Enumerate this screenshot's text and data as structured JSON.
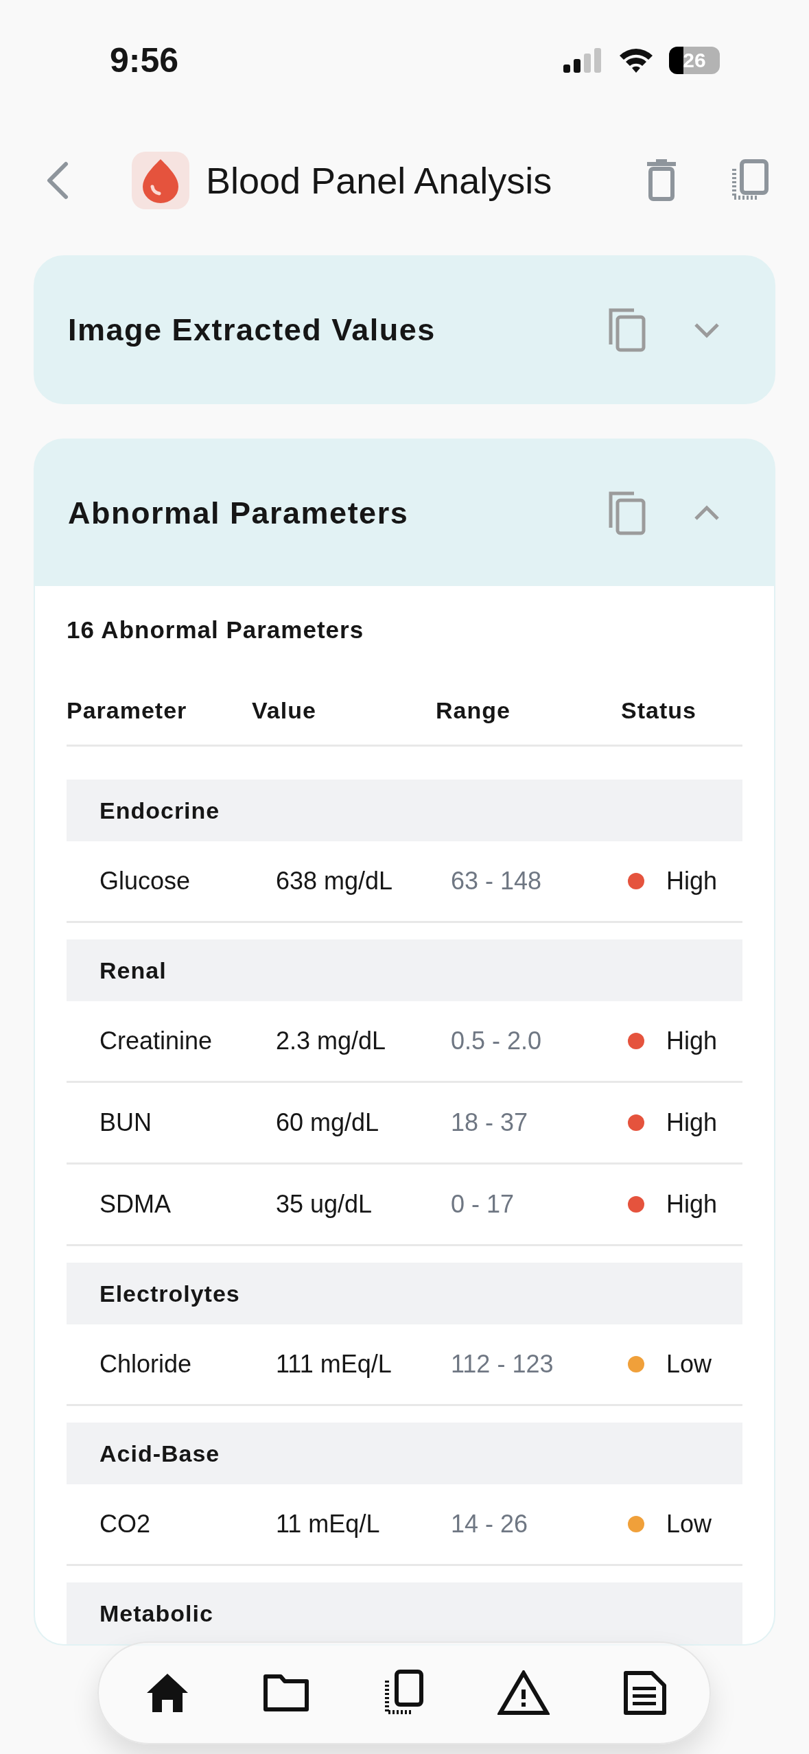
{
  "status_bar": {
    "time": "9:56",
    "battery": "26"
  },
  "header": {
    "title": "Blood Panel Analysis"
  },
  "sections": [
    {
      "title": "Image Extracted Values",
      "expanded": false
    },
    {
      "title": "Abnormal Parameters",
      "expanded": true,
      "summary": "16 Abnormal Parameters",
      "columns": [
        "Parameter",
        "Value",
        "Range",
        "Status"
      ],
      "groups": [
        {
          "name": "Endocrine",
          "rows": [
            {
              "parameter": "Glucose",
              "value": "638 mg/dL",
              "range": "63 - 148",
              "status": "High",
              "color": "#e5533d"
            }
          ]
        },
        {
          "name": "Renal",
          "rows": [
            {
              "parameter": "Creatinine",
              "value": "2.3 mg/dL",
              "range": "0.5 - 2.0",
              "status": "High",
              "color": "#e5533d"
            },
            {
              "parameter": "BUN",
              "value": "60 mg/dL",
              "range": "18 - 37",
              "status": "High",
              "color": "#e5533d"
            },
            {
              "parameter": "SDMA",
              "value": "35 ug/dL",
              "range": "0 - 17",
              "status": "High",
              "color": "#e5533d"
            }
          ]
        },
        {
          "name": "Electrolytes",
          "rows": [
            {
              "parameter": "Chloride",
              "value": "111 mEq/L",
              "range": "112 - 123",
              "status": "Low",
              "color": "#f0a03a"
            }
          ]
        },
        {
          "name": "Acid-Base",
          "rows": [
            {
              "parameter": "CO2",
              "value": "11 mEq/L",
              "range": "14 - 26",
              "status": "Low",
              "color": "#f0a03a"
            }
          ]
        },
        {
          "name": "Metabolic"
        }
      ]
    }
  ]
}
